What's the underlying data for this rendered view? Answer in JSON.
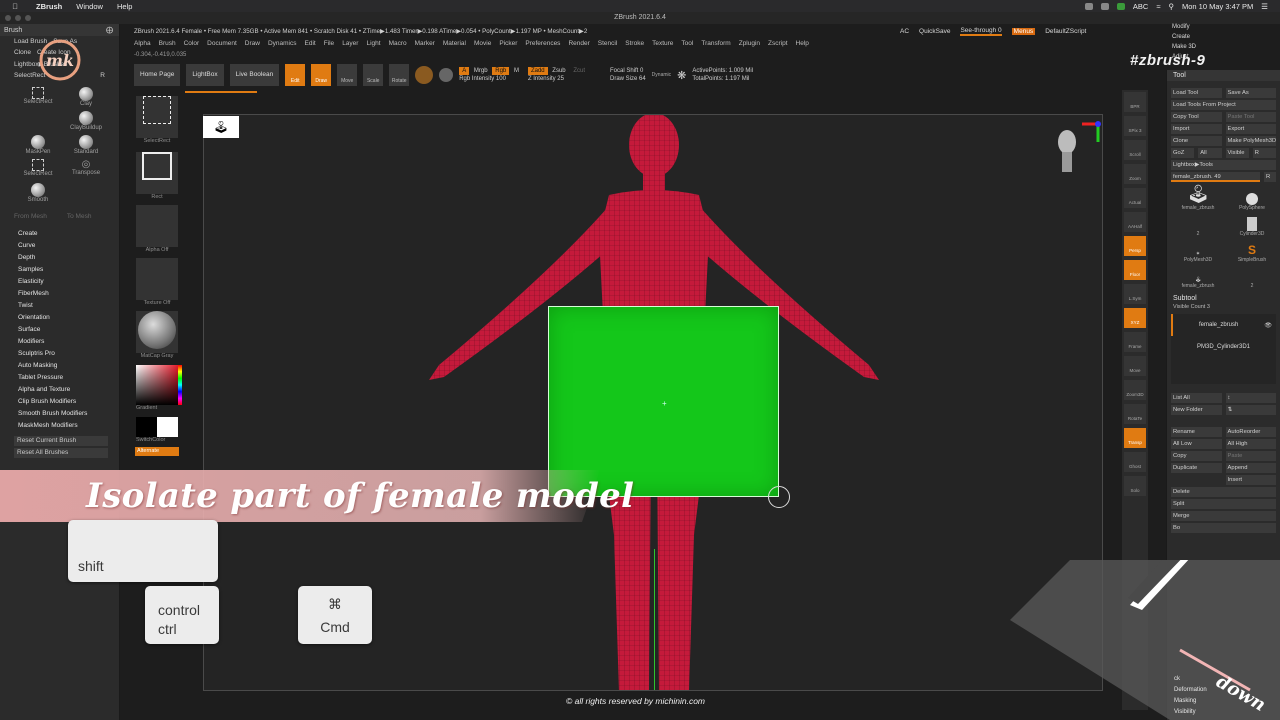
{
  "mac_menubar": {
    "app": "ZBrush",
    "menus": [
      "Window",
      "Help"
    ],
    "clock": "Mon 10 May 3:47 PM",
    "input_source": "ABC"
  },
  "app_title": "ZBrush 2021.6.4",
  "info_bar": "ZBrush 2021.6.4 Female   • Free Mem 7.35GB • Active Mem 841 • Scratch Disk 41 • ZTime▶1.483 Timer▶0.198 ATime▶0.054 • PolyCount▶1.197 MP • MeshCount▶2",
  "main_menu": [
    "Alpha",
    "Brush",
    "Color",
    "Document",
    "Draw",
    "Dynamics",
    "Edit",
    "File",
    "Layer",
    "Light",
    "Macro",
    "Marker",
    "Material",
    "Movie",
    "Picker",
    "Preferences",
    "Render",
    "Stencil",
    "Stroke",
    "Texture",
    "Tool",
    "Transform",
    "Zplugin",
    "Zscript",
    "Help"
  ],
  "coords": "-0.304,-0.419,0.035",
  "top_right": {
    "ac": "AC",
    "quicksave": "QuickSave",
    "see_through": "See-through  0",
    "menus": "Menus",
    "default_zscript": "DefaultZScript"
  },
  "shelf": {
    "home_page": "Home Page",
    "lightbox": "LightBox",
    "live_boolean": "Live Boolean",
    "tools": [
      "Edit",
      "Draw",
      "Move",
      "Scale",
      "Rotate"
    ],
    "a": "A",
    "mrgb": "Mrgb",
    "rgb": "Rgb",
    "m": "M",
    "zadd": "Zadd",
    "zsub": "Zsub",
    "zcut": "Zcut",
    "rgb_intensity": "Rgb Intensity 100",
    "z_intensity": "Z Intensity 25",
    "focal_shift": "Focal Shift 0",
    "draw_size": "Draw Size 64",
    "dynamic": "Dynamic",
    "active_points": "ActivePoints: 1.009 Mil",
    "total_points": "TotalPoints: 1.197 Mil"
  },
  "left_panel": {
    "title": "Brush",
    "top_items": [
      "Load Brush",
      "Save As",
      "Clone",
      "Create Icon",
      "Lightbox▶Brushes",
      "SelectRect",
      "R"
    ],
    "brushes": [
      "SelectRect",
      "Clay",
      "ClayBuildup",
      "MaskPen",
      "Standard",
      "SelectRect",
      "Transpose",
      "Smooth"
    ],
    "from_mesh": "From Mesh",
    "to_mesh": "To Mesh",
    "menu": [
      "Create",
      "Curve",
      "Depth",
      "Samples",
      "Elasticity",
      "FiberMesh",
      "Twist",
      "Orientation",
      "Surface",
      "Modifiers",
      "Sculptris Pro",
      "Auto Masking",
      "Tablet Pressure",
      "Alpha and Texture",
      "Clip Brush Modifiers",
      "Smooth Brush Modifiers",
      "MaskMesh Modifiers"
    ],
    "reset_current": "Reset Current Brush",
    "reset_all": "Reset All Brushes"
  },
  "col2": {
    "select_rect": "SelectRect",
    "rect": "Rect",
    "alpha_off": "Alpha Off",
    "texture_off": "Texture Off",
    "matcap": "MatCap Gray",
    "gradient": "Gradient",
    "switch_color": "SwitchColor",
    "alternate": "Alternate"
  },
  "right_icons": [
    "BPR",
    "SPix 3",
    "Scroll",
    "Zoom",
    "Actual",
    "AAHalf",
    "Persp",
    "Floor",
    "L.Sym",
    "XYZ",
    "Frame",
    "Move",
    "Zoom3D",
    "RotaTe",
    "Transp",
    "Ghost",
    "Solo"
  ],
  "right_panel": {
    "top_list": [
      "Modify",
      "Create",
      "Make 3D",
      "Adjust"
    ],
    "title": "Tool",
    "rows": [
      [
        "Load Tool",
        "Save As"
      ],
      [
        "Load Tools From Project",
        ""
      ],
      [
        "Copy Tool",
        "Paste Tool"
      ],
      [
        "Import",
        "Export"
      ],
      [
        "Clone",
        "Make PolyMesh3D"
      ],
      [
        "GoZ",
        "All",
        "Visible",
        "R"
      ],
      [
        "Lightbox▶Tools",
        ""
      ],
      [
        "female_zbrush. 49",
        "R"
      ]
    ],
    "thumbs": [
      "female_zbrush",
      "PolySphere",
      "Cylinder3D",
      "PolyMesh3D",
      "SimpleBrush",
      "female_zbrush"
    ],
    "thumb_counts": [
      "2",
      "2"
    ],
    "subtool_title": "Subtool",
    "visible_count": "Visible Count 3",
    "subtools": [
      "female_zbrush",
      "PM3D_Cylinder3D1"
    ],
    "list_all": "List All",
    "new_folder": "New Folder",
    "rename": "Rename",
    "auto_reorder": "AutoReorder",
    "all_low": "All Low",
    "all_high": "All High",
    "copy": "Copy",
    "paste": "Paste",
    "duplicate": "Duplicate",
    "append": "Append",
    "insert": "Insert",
    "delete": "Delete",
    "split": "Split",
    "merge": "Merge",
    "bool": "Bo",
    "bottom_list": [
      "Deformation",
      "Masking",
      "Visibility"
    ],
    "bottom_partial": "ck"
  },
  "overlay": {
    "tag": "#zbrush-9",
    "banner": "Isolate part of female model",
    "keys": {
      "shift": "shift",
      "control": "control",
      "ctrl": "ctrl",
      "cmd_glyph": "⌘",
      "cmd": "Cmd"
    },
    "pen_action": "down",
    "copyright": "© all rights reserved by michinin.com",
    "logo_text": "mk"
  },
  "colors": {
    "accent": "#e07b12",
    "selection": "#14c71a",
    "model": "#c8183a",
    "banner": "#e8a8a8"
  }
}
